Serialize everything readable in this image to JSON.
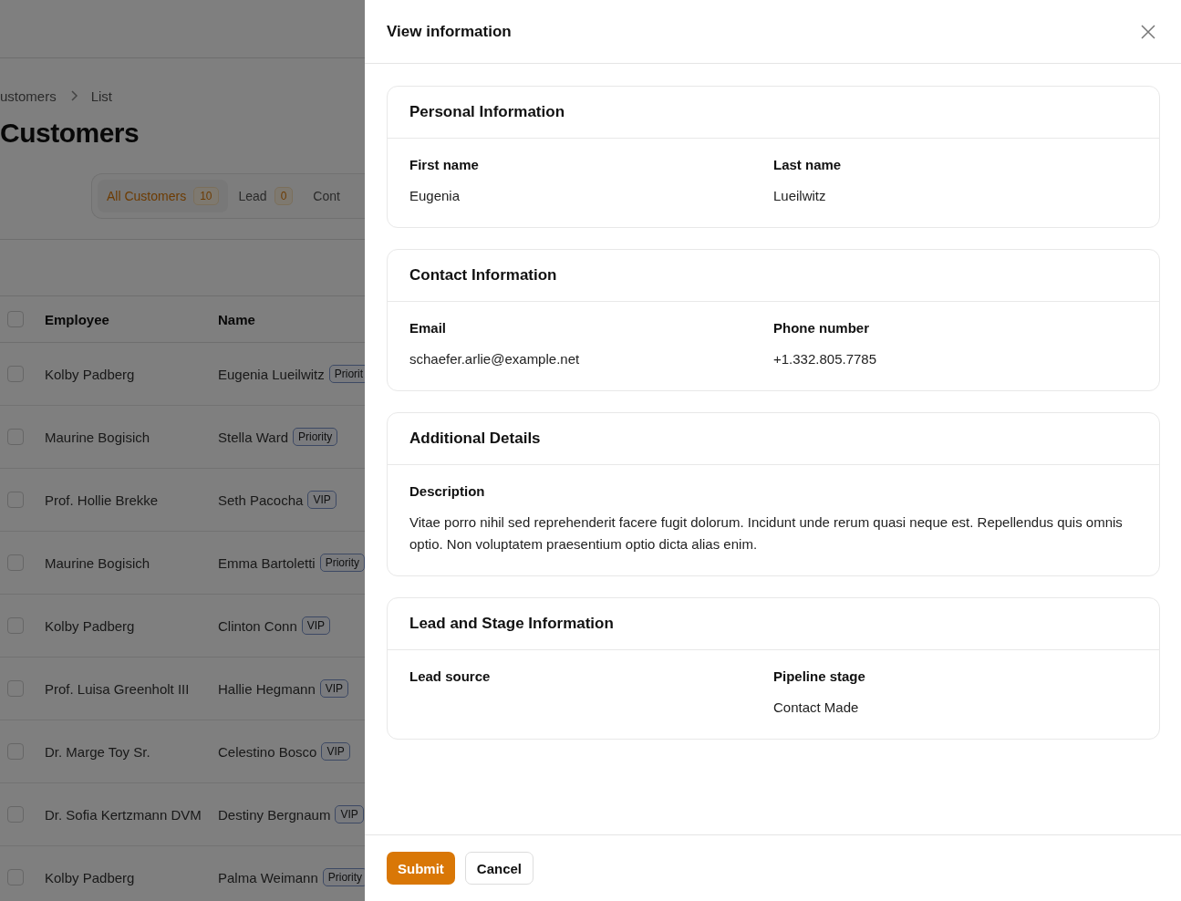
{
  "breadcrumb": [
    "ustomers",
    "List"
  ],
  "page_title": "Customers",
  "tabs": [
    {
      "label": "All Customers",
      "count": "10",
      "selected": true
    },
    {
      "label": "Lead",
      "count": "0",
      "selected": false
    },
    {
      "label": "Cont",
      "selected": false
    }
  ],
  "table": {
    "select_all_checked": false,
    "columns": [
      "Employee",
      "Name"
    ],
    "rows": [
      {
        "employee": "Kolby Padberg",
        "name": "Eugenia Lueilwitz",
        "tag": "Priorit",
        "checked": false
      },
      {
        "employee": "Maurine Bogisich",
        "name": "Stella Ward",
        "tag": "Priority",
        "checked": false
      },
      {
        "employee": "Prof. Hollie Brekke",
        "name": "Seth Pacocha",
        "tag": "VIP",
        "checked": false
      },
      {
        "employee": "Maurine Bogisich",
        "name": "Emma Bartoletti",
        "tag": "Priority",
        "checked": false
      },
      {
        "employee": "Kolby Padberg",
        "name": "Clinton Conn",
        "tag": "VIP",
        "checked": false
      },
      {
        "employee": "Prof. Luisa Greenholt III",
        "name": "Hallie Hegmann",
        "tag": "VIP",
        "checked": false
      },
      {
        "employee": "Dr. Marge Toy Sr.",
        "name": "Celestino Bosco",
        "tag": "VIP",
        "checked": false
      },
      {
        "employee": "Dr. Sofia Kertzmann DVM",
        "name": "Destiny Bergnaum",
        "tag": "VIP",
        "checked": false
      },
      {
        "employee": "Kolby Padberg",
        "name": "Palma Weimann",
        "tag": "Priority",
        "checked": false
      }
    ]
  },
  "panel": {
    "title": "View information",
    "sections": [
      {
        "title": "Personal Information",
        "fields": [
          {
            "label": "First name",
            "value": "Eugenia"
          },
          {
            "label": "Last name",
            "value": "Lueilwitz"
          }
        ]
      },
      {
        "title": "Contact Information",
        "fields": [
          {
            "label": "Email",
            "value": "schaefer.arlie@example.net"
          },
          {
            "label": "Phone number",
            "value": "+1.332.805.7785"
          }
        ]
      },
      {
        "title": "Additional Details",
        "fields": [
          {
            "label": "Description",
            "value": "Vitae porro nihil sed reprehenderit facere fugit dolorum. Incidunt unde rerum quasi neque est. Repellendus quis omnis optio. Non voluptatem praesentium optio dicta alias enim."
          }
        ]
      },
      {
        "title": "Lead and Stage Information",
        "fields": [
          {
            "label": "Lead source"
          },
          {
            "label": "Pipeline stage",
            "value": "Contact Made"
          }
        ]
      }
    ],
    "buttons": [
      {
        "label": "Submit",
        "kind": "primary"
      },
      {
        "label": "Cancel",
        "kind": "secondary"
      }
    ]
  }
}
